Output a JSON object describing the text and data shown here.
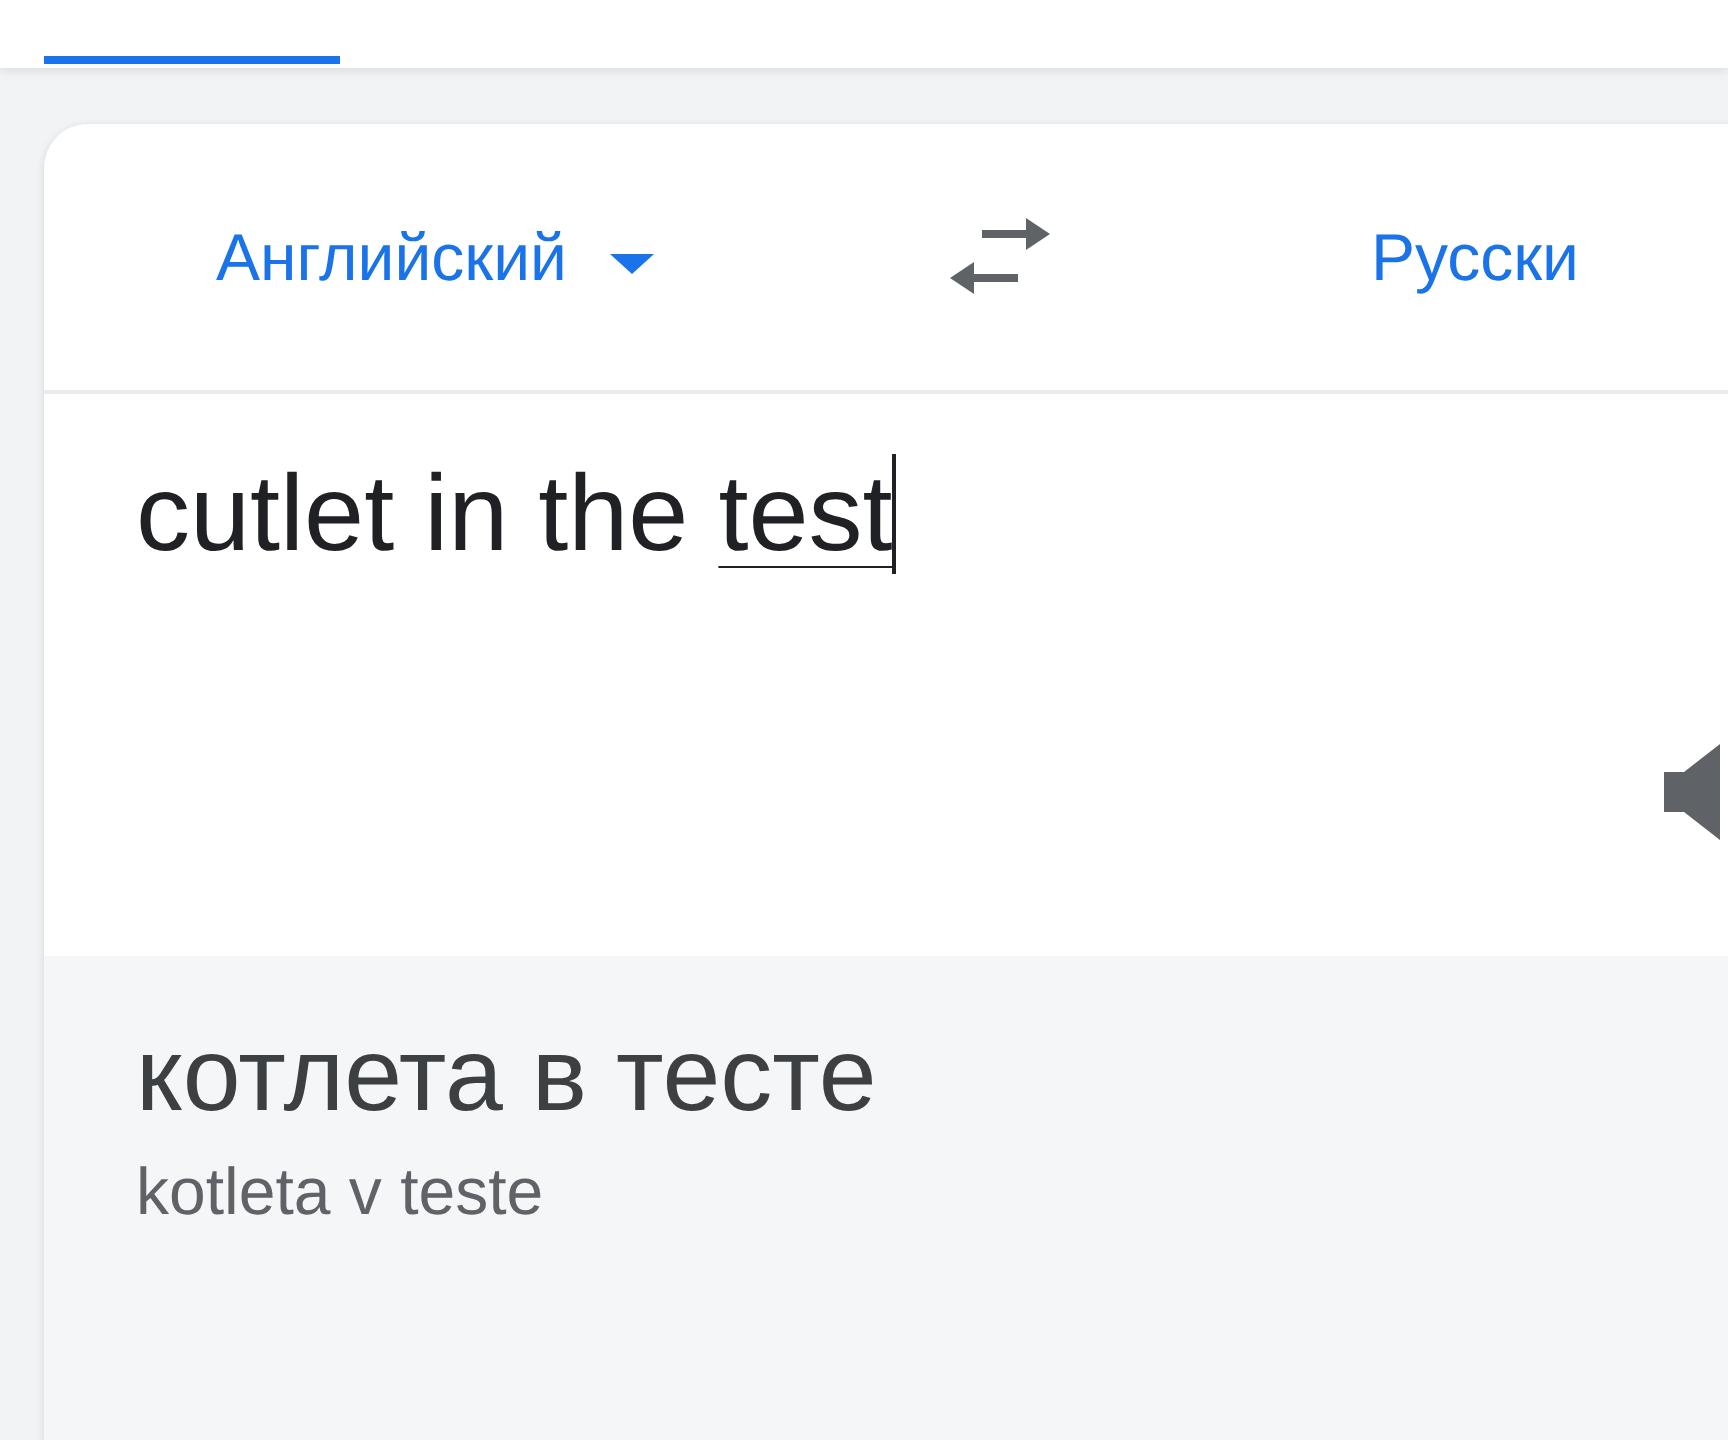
{
  "tab_indicator": {
    "selected": true
  },
  "language_bar": {
    "source": "Английский",
    "target": "Русски"
  },
  "input": {
    "text": "cutlet in the ",
    "composing": "test"
  },
  "translation": {
    "text": "котлета в тесте",
    "transliteration": "kotleta v teste"
  }
}
